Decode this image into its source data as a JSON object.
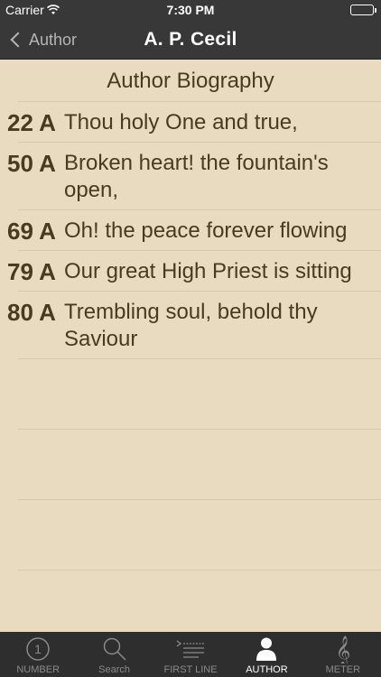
{
  "status": {
    "carrier": "Carrier",
    "time": "7:30 PM"
  },
  "nav": {
    "back_label": "Author",
    "title": "A. P. Cecil"
  },
  "bio_header": "Author Biography",
  "hymns": [
    {
      "number": "22 A",
      "text": "Thou holy One and true,"
    },
    {
      "number": "50 A",
      "text": "Broken heart! the fountain's open,"
    },
    {
      "number": "69 A",
      "text": "Oh! the peace forever flowing"
    },
    {
      "number": "79 A",
      "text": "Our great High Priest is sitting"
    },
    {
      "number": "80 A",
      "text": "Trembling soul, behold thy Saviour"
    }
  ],
  "tabs": [
    {
      "label": "NUMBER",
      "icon": "number-icon",
      "active": false
    },
    {
      "label": "Search",
      "icon": "search-icon",
      "active": false
    },
    {
      "label": "FIRST LINE",
      "icon": "first-line-icon",
      "active": false
    },
    {
      "label": "AUTHOR",
      "icon": "author-icon",
      "active": true
    },
    {
      "label": "METER",
      "icon": "treble-clef-icon",
      "active": false
    }
  ],
  "colors": {
    "background": "#e8dbbf",
    "text": "#4a3b20",
    "bar": "#383838",
    "tab_bar": "#2e2e2e"
  }
}
